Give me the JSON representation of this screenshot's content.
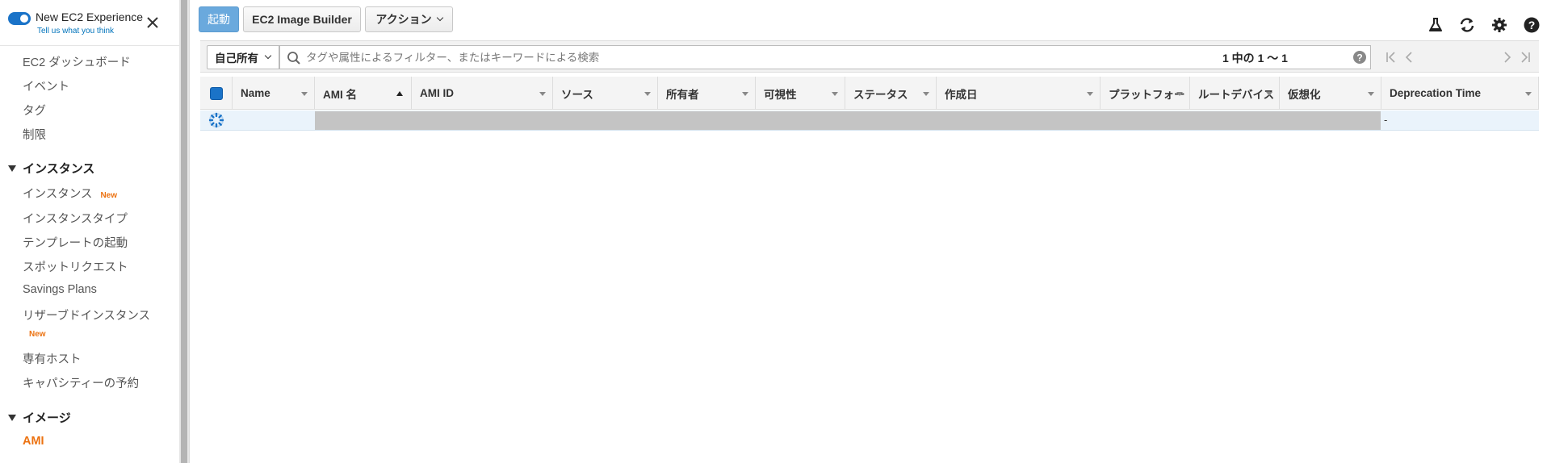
{
  "sidebar": {
    "experience_title": "New EC2 Experience",
    "experience_subtitle": "Tell us what you think",
    "items": [
      {
        "label": "EC2 ダッシュボード"
      },
      {
        "label": "イベント"
      },
      {
        "label": "タグ"
      },
      {
        "label": "制限"
      }
    ],
    "section_instances": "インスタンス",
    "instances_items": [
      {
        "label": "インスタンス",
        "badge": "New"
      },
      {
        "label": "インスタンスタイプ"
      },
      {
        "label": "テンプレートの起動"
      },
      {
        "label": "スポットリクエスト"
      },
      {
        "label": "Savings Plans"
      },
      {
        "label": "リザーブドインスタンス",
        "badge": "New"
      },
      {
        "label": "専有ホスト"
      },
      {
        "label": "キャパシティーの予約"
      }
    ],
    "section_images": "イメージ",
    "images_items": [
      {
        "label": "AMI",
        "active": true
      }
    ]
  },
  "toolbar": {
    "launch_label": "起動",
    "image_builder_label": "EC2 Image Builder",
    "actions_label": "アクション"
  },
  "filter": {
    "owner_value": "自己所有",
    "search_placeholder": "タグや属性によるフィルター、またはキーワードによる検索",
    "pagination_text": "1 中の 1 〜 1"
  },
  "table": {
    "columns": [
      {
        "label": "Name"
      },
      {
        "label": "AMI 名"
      },
      {
        "label": "AMI ID"
      },
      {
        "label": "ソース"
      },
      {
        "label": "所有者"
      },
      {
        "label": "可視性"
      },
      {
        "label": "ステータス"
      },
      {
        "label": "作成日"
      },
      {
        "label": "プラットフォー"
      },
      {
        "label": "ルートデバイス"
      },
      {
        "label": "仮想化"
      },
      {
        "label": "Deprecation Time"
      }
    ],
    "sorted_column": "AMI 名",
    "rows": [
      {
        "deprecation_time": "-"
      }
    ]
  },
  "colors": {
    "accent_blue": "#1a73c8",
    "active_orange": "#ec7211",
    "primary_button": "#6aa9dd",
    "selected_row": "#eaf3fb"
  }
}
